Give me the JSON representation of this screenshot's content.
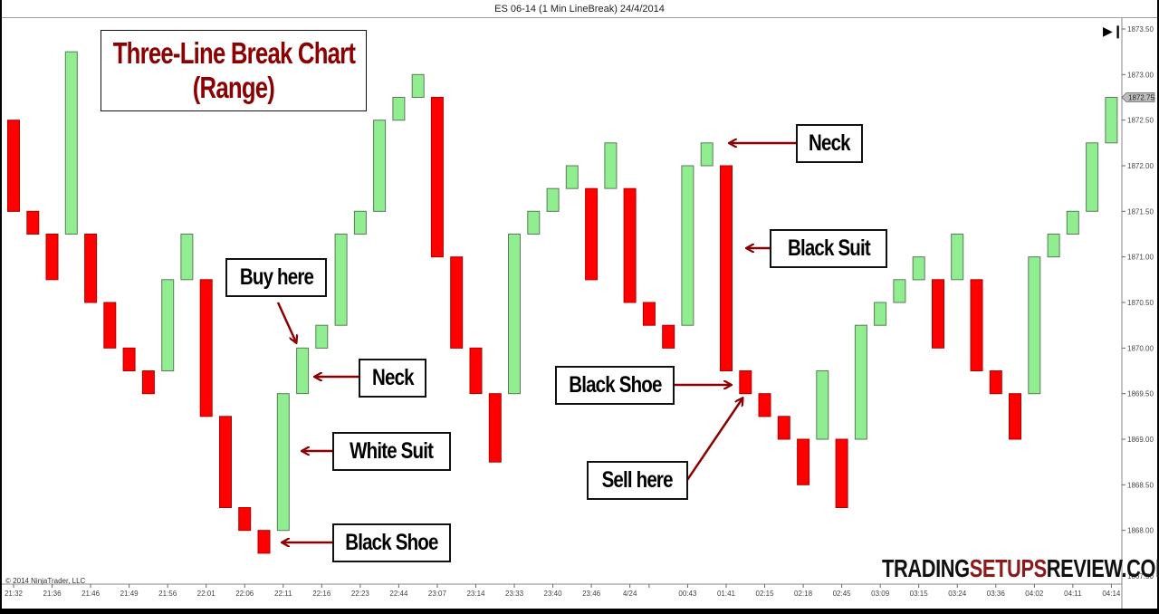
{
  "window": {
    "title": "ES 06-14 (1 Min LineBreak)  24/4/2014",
    "copyright": "© 2014 NinjaTrader, LLC",
    "scroll_end_icon": "skip-to-end-icon"
  },
  "watermark": {
    "left": "TRADING",
    "middle": "SETUPS",
    "right": "REVIEW.COM"
  },
  "colors": {
    "up_bar": "#90ee90",
    "down_bar": "#ff0000",
    "bar_outline": "#4a6a4a",
    "annotation": "#8b0000"
  },
  "annotations": {
    "title_line1": "Three-Line Break Chart",
    "title_line2": "(Range)",
    "buy_here": "Buy here",
    "neck_left": "Neck",
    "white_suit": "White Suit",
    "black_shoe_left": "Black Shoe",
    "neck_right": "Neck",
    "black_suit": "Black Suit",
    "black_shoe_right": "Black Shoe",
    "sell_here": "Sell here"
  },
  "chart_data": {
    "type": "bar",
    "subtype": "three-line-break",
    "title": "ES 06-14 (1 Min LineBreak)  24/4/2014",
    "xlabel": "",
    "ylabel": "",
    "ylim": [
      1867.5,
      1873.5
    ],
    "yticks": [
      "1867.50",
      "1868.00",
      "1868.50",
      "1869.00",
      "1869.50",
      "1870.00",
      "1870.50",
      "1871.00",
      "1871.50",
      "1872.00",
      "1872.50",
      "1873.00",
      "1873.50"
    ],
    "last_price": "1872.75",
    "grid": false,
    "xtick_labels": [
      {
        "bar": 0,
        "label": "21:32"
      },
      {
        "bar": 2,
        "label": "21:36"
      },
      {
        "bar": 4,
        "label": "21:46"
      },
      {
        "bar": 6,
        "label": "21:49"
      },
      {
        "bar": 8,
        "label": "21:56"
      },
      {
        "bar": 10,
        "label": "22:01"
      },
      {
        "bar": 12,
        "label": "22:06"
      },
      {
        "bar": 14,
        "label": "22:11"
      },
      {
        "bar": 16,
        "label": "22:16"
      },
      {
        "bar": 18,
        "label": "22:23"
      },
      {
        "bar": 20,
        "label": "22:44"
      },
      {
        "bar": 22,
        "label": "23:07"
      },
      {
        "bar": 24,
        "label": "23:14"
      },
      {
        "bar": 26,
        "label": "23:33"
      },
      {
        "bar": 28,
        "label": "23:40"
      },
      {
        "bar": 30,
        "label": "23:46"
      },
      {
        "bar": 32,
        "label": "4/24"
      },
      {
        "bar": 33,
        "label": ""
      },
      {
        "bar": 35,
        "label": "00:43"
      },
      {
        "bar": 37,
        "label": "01:41"
      },
      {
        "bar": 39,
        "label": "02:15"
      },
      {
        "bar": 41,
        "label": "02:18"
      },
      {
        "bar": 43,
        "label": "02:45"
      },
      {
        "bar": 45,
        "label": "03:09"
      },
      {
        "bar": 47,
        "label": "03:15"
      },
      {
        "bar": 49,
        "label": "03:24"
      },
      {
        "bar": 51,
        "label": "03:36"
      },
      {
        "bar": 53,
        "label": "04:02"
      },
      {
        "bar": 55,
        "label": "04:11"
      },
      {
        "bar": 57,
        "label": "04:14"
      }
    ],
    "bars": [
      {
        "dir": "down",
        "open": 1872.5,
        "close": 1871.5
      },
      {
        "dir": "down",
        "open": 1871.5,
        "close": 1871.25
      },
      {
        "dir": "down",
        "open": 1871.25,
        "close": 1870.75
      },
      {
        "dir": "up",
        "open": 1871.25,
        "close": 1873.25
      },
      {
        "dir": "down",
        "open": 1871.25,
        "close": 1870.5
      },
      {
        "dir": "down",
        "open": 1870.5,
        "close": 1870.0
      },
      {
        "dir": "down",
        "open": 1870.0,
        "close": 1869.75
      },
      {
        "dir": "down",
        "open": 1869.75,
        "close": 1869.5
      },
      {
        "dir": "up",
        "open": 1869.75,
        "close": 1870.75
      },
      {
        "dir": "up",
        "open": 1870.75,
        "close": 1871.25
      },
      {
        "dir": "down",
        "open": 1870.75,
        "close": 1869.25
      },
      {
        "dir": "down",
        "open": 1869.25,
        "close": 1868.25
      },
      {
        "dir": "down",
        "open": 1868.25,
        "close": 1868.0
      },
      {
        "dir": "down",
        "open": 1868.0,
        "close": 1867.75
      },
      {
        "dir": "up",
        "open": 1868.0,
        "close": 1869.5
      },
      {
        "dir": "up",
        "open": 1869.5,
        "close": 1870.0
      },
      {
        "dir": "up",
        "open": 1870.0,
        "close": 1870.25
      },
      {
        "dir": "up",
        "open": 1870.25,
        "close": 1871.25
      },
      {
        "dir": "up",
        "open": 1871.25,
        "close": 1871.5
      },
      {
        "dir": "up",
        "open": 1871.5,
        "close": 1872.5
      },
      {
        "dir": "up",
        "open": 1872.5,
        "close": 1872.75
      },
      {
        "dir": "up",
        "open": 1872.75,
        "close": 1873.0
      },
      {
        "dir": "down",
        "open": 1872.75,
        "close": 1871.0
      },
      {
        "dir": "down",
        "open": 1871.0,
        "close": 1870.0
      },
      {
        "dir": "down",
        "open": 1870.0,
        "close": 1869.5
      },
      {
        "dir": "down",
        "open": 1869.5,
        "close": 1868.75
      },
      {
        "dir": "up",
        "open": 1869.5,
        "close": 1871.25
      },
      {
        "dir": "up",
        "open": 1871.25,
        "close": 1871.5
      },
      {
        "dir": "up",
        "open": 1871.5,
        "close": 1871.75
      },
      {
        "dir": "up",
        "open": 1871.75,
        "close": 1872.0
      },
      {
        "dir": "down",
        "open": 1871.75,
        "close": 1870.75
      },
      {
        "dir": "up",
        "open": 1871.75,
        "close": 1872.25
      },
      {
        "dir": "down",
        "open": 1871.75,
        "close": 1870.5
      },
      {
        "dir": "down",
        "open": 1870.5,
        "close": 1870.25
      },
      {
        "dir": "down",
        "open": 1870.25,
        "close": 1870.0
      },
      {
        "dir": "up",
        "open": 1870.25,
        "close": 1872.0
      },
      {
        "dir": "up",
        "open": 1872.0,
        "close": 1872.25
      },
      {
        "dir": "down",
        "open": 1872.0,
        "close": 1869.75
      },
      {
        "dir": "down",
        "open": 1869.75,
        "close": 1869.5
      },
      {
        "dir": "down",
        "open": 1869.5,
        "close": 1869.25
      },
      {
        "dir": "down",
        "open": 1869.25,
        "close": 1869.0
      },
      {
        "dir": "down",
        "open": 1869.0,
        "close": 1868.5
      },
      {
        "dir": "up",
        "open": 1869.0,
        "close": 1869.75
      },
      {
        "dir": "down",
        "open": 1869.0,
        "close": 1868.25
      },
      {
        "dir": "up",
        "open": 1869.0,
        "close": 1870.25
      },
      {
        "dir": "up",
        "open": 1870.25,
        "close": 1870.5
      },
      {
        "dir": "up",
        "open": 1870.5,
        "close": 1870.75
      },
      {
        "dir": "up",
        "open": 1870.75,
        "close": 1871.0
      },
      {
        "dir": "down",
        "open": 1870.75,
        "close": 1870.0
      },
      {
        "dir": "up",
        "open": 1870.75,
        "close": 1871.25
      },
      {
        "dir": "down",
        "open": 1870.75,
        "close": 1869.75
      },
      {
        "dir": "down",
        "open": 1869.75,
        "close": 1869.5
      },
      {
        "dir": "down",
        "open": 1869.5,
        "close": 1869.0
      },
      {
        "dir": "up",
        "open": 1869.5,
        "close": 1871.0
      },
      {
        "dir": "up",
        "open": 1871.0,
        "close": 1871.25
      },
      {
        "dir": "up",
        "open": 1871.25,
        "close": 1871.5
      },
      {
        "dir": "up",
        "open": 1871.5,
        "close": 1872.25
      },
      {
        "dir": "up",
        "open": 1872.25,
        "close": 1872.75
      }
    ],
    "pattern_annotations": [
      {
        "label": "Buy here",
        "bar": 15
      },
      {
        "label": "Neck",
        "bar": 15
      },
      {
        "label": "White Suit",
        "bar": 14
      },
      {
        "label": "Black Shoe",
        "bar": 13
      },
      {
        "label": "Neck",
        "bar": 36
      },
      {
        "label": "Black Suit",
        "bar": 37
      },
      {
        "label": "Black Shoe",
        "bar": 38
      },
      {
        "label": "Sell here",
        "bar": 38
      }
    ]
  }
}
